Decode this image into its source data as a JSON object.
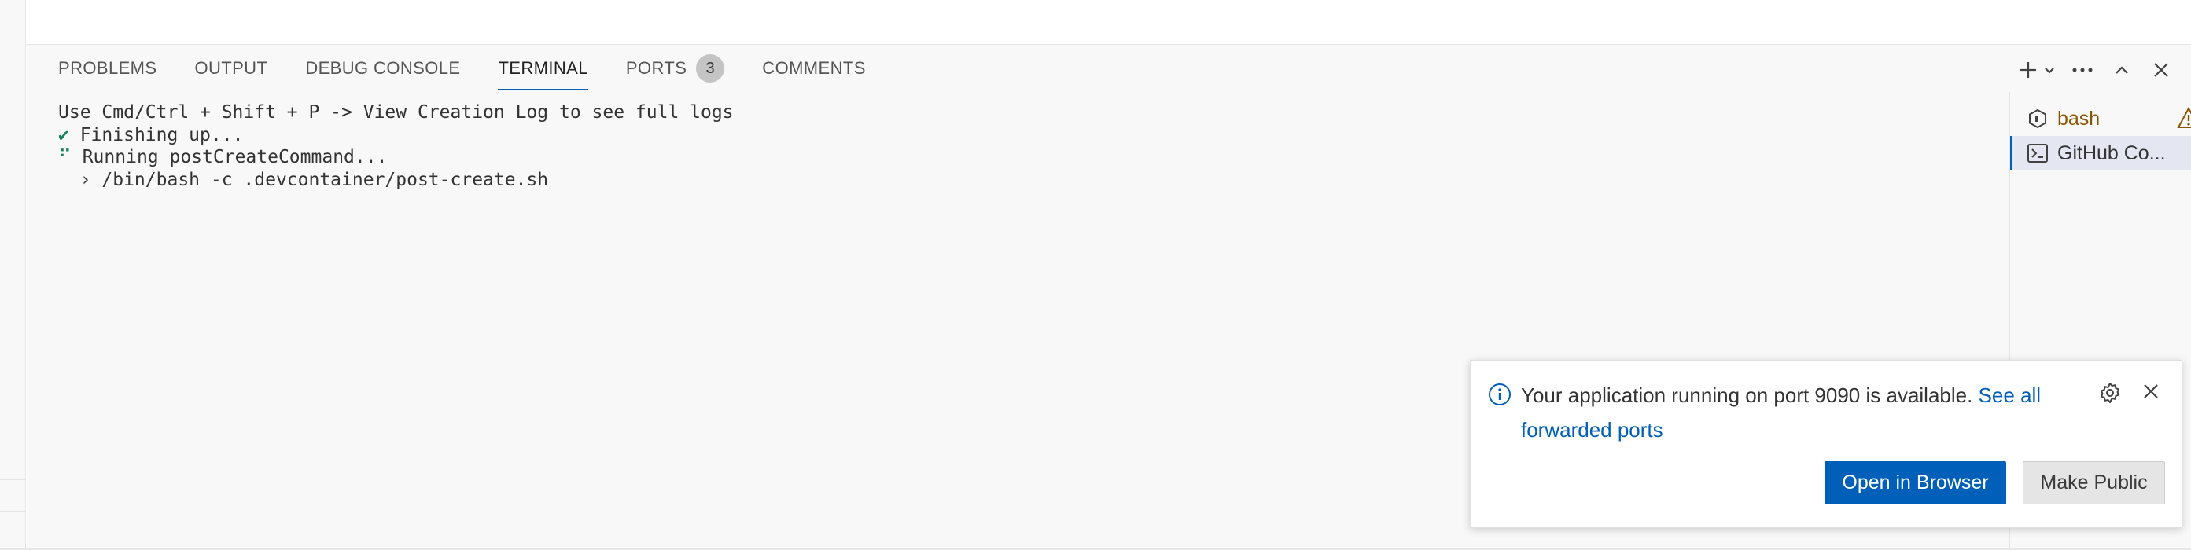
{
  "panel": {
    "tabs": [
      {
        "label": "PROBLEMS"
      },
      {
        "label": "OUTPUT"
      },
      {
        "label": "DEBUG CONSOLE"
      },
      {
        "label": "TERMINAL",
        "active": true
      },
      {
        "label": "PORTS",
        "badge": "3"
      },
      {
        "label": "COMMENTS"
      }
    ],
    "actions": [
      "plus-icon",
      "chevron-down-icon",
      "more-icon",
      "chevron-up-icon",
      "close-icon"
    ]
  },
  "terminal": {
    "lines": [
      {
        "prefix": "",
        "text": "Use Cmd/Ctrl + Shift + P -> View Creation Log to see full logs"
      },
      {
        "prefix": "✔",
        "text": " Finishing up..."
      },
      {
        "prefix": "⠋",
        "text": " Running postCreateCommand..."
      },
      {
        "prefix": "",
        "text": "  › /bin/bash -c .devcontainer/post-create.sh"
      }
    ]
  },
  "terminal_list": [
    {
      "name": "bash",
      "icon": "bash-icon",
      "warning": true
    },
    {
      "name": "GitHub Co...",
      "icon": "terminal-icon",
      "selected": true
    }
  ],
  "notification": {
    "message": "Your application running on port 9090 is available.",
    "link": "See all forwarded ports",
    "primary_button": "Open in Browser",
    "secondary_button": "Make Public"
  },
  "colors": {
    "accent": "#005fb8",
    "check": "#16825d",
    "warning": "#895503"
  }
}
